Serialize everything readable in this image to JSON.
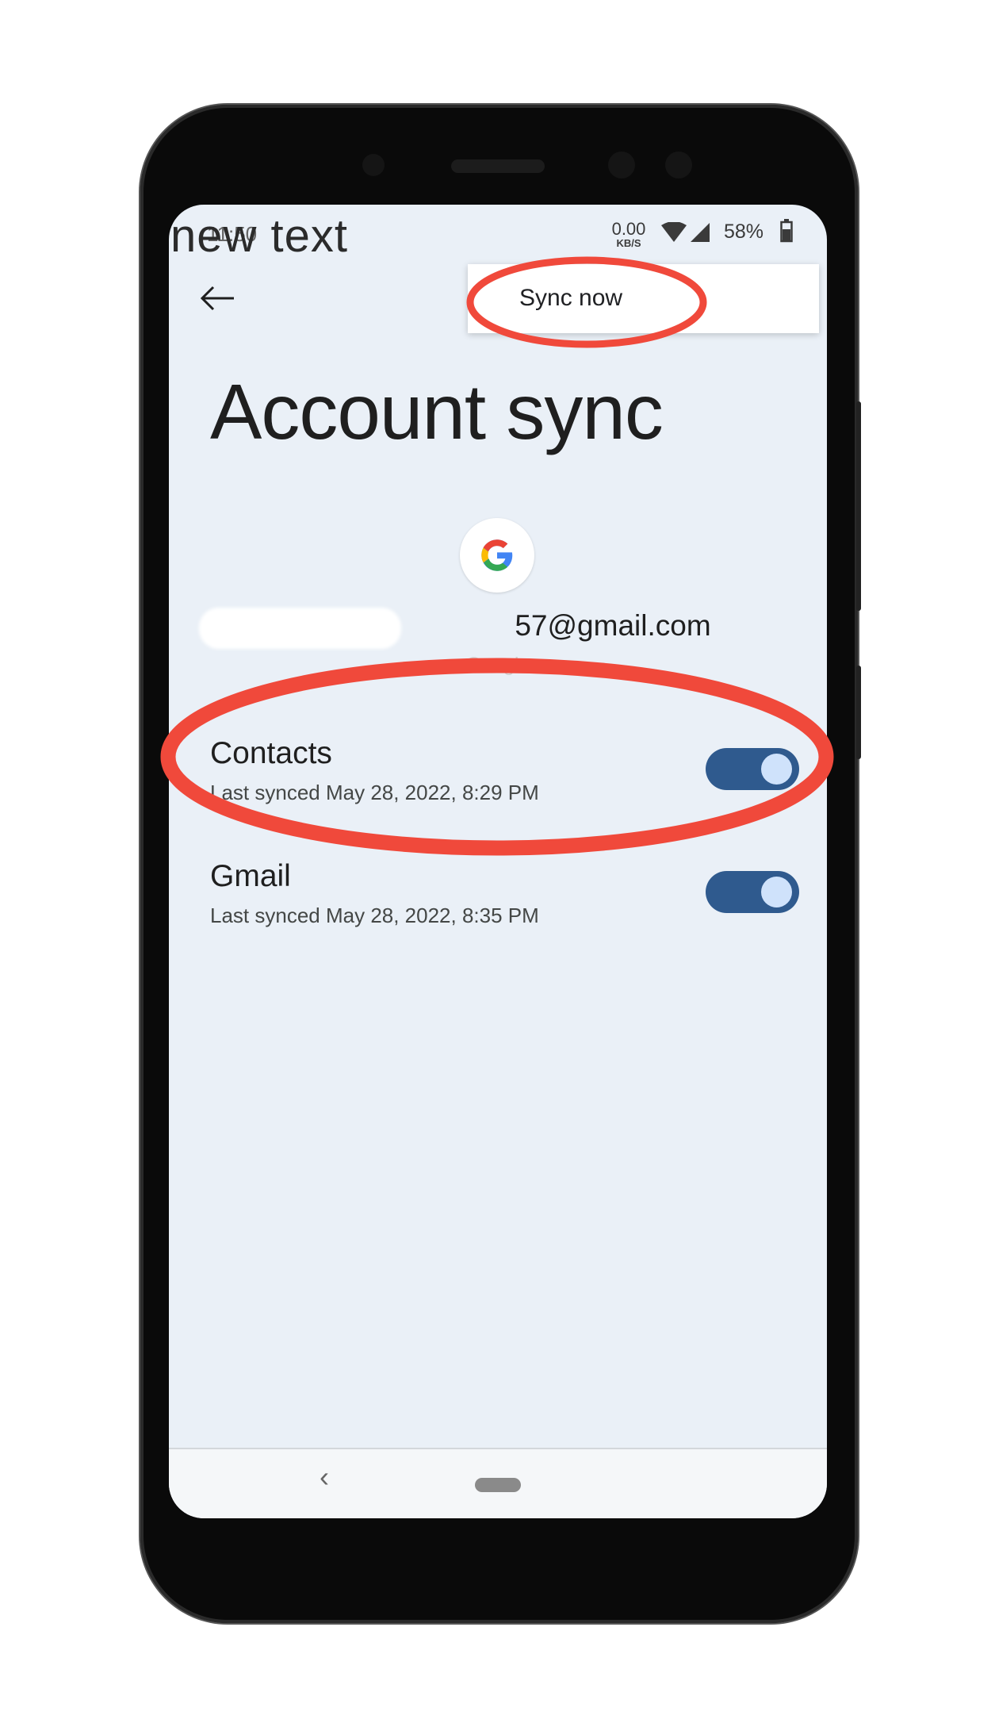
{
  "overlay_text": "new text",
  "status_bar": {
    "time": "11:50",
    "net_speed": "0.00",
    "net_unit": "KB/S",
    "battery": "58%",
    "icons": [
      "wifi-icon",
      "signal-icon",
      "battery-icon"
    ]
  },
  "menu": {
    "items": [
      {
        "label": "Sync now"
      }
    ]
  },
  "page": {
    "title": "Account sync"
  },
  "account": {
    "email": "57@gmail.com",
    "provider": "Google",
    "icon": "google-logo"
  },
  "sync_items": [
    {
      "title": "Contacts",
      "subtitle": "Last synced May 28, 2022, 8:29 PM",
      "enabled": true
    },
    {
      "title": "Gmail",
      "subtitle": "Last synced May 28, 2022, 8:35 PM",
      "enabled": true
    }
  ],
  "colors": {
    "background": "#eaf0f7",
    "toggle_on": "#2f5a8e",
    "toggle_knob": "#cfe2fb",
    "annotation": "#f0493b"
  }
}
